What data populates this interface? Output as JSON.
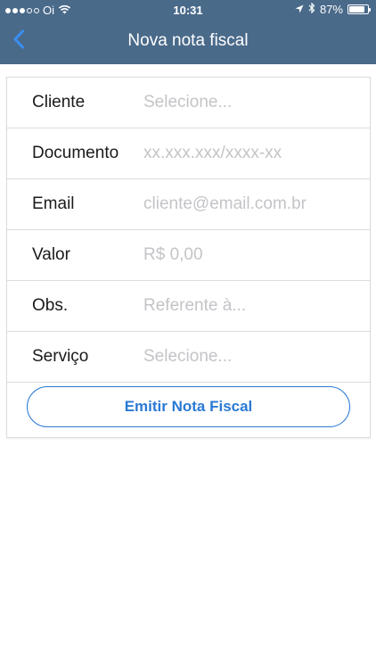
{
  "status_bar": {
    "carrier": "Oi",
    "time": "10:31",
    "battery": "87%",
    "battery_level": 0.87,
    "icons": [
      "signal-dots-icon",
      "wifi-icon",
      "location-arrow-icon",
      "bluetooth-icon",
      "battery-icon"
    ]
  },
  "nav": {
    "title": "Nova nota fiscal",
    "back_icon": "chevron-left-icon"
  },
  "form": {
    "fields": [
      {
        "label": "Cliente",
        "placeholder": "Selecione...",
        "value": ""
      },
      {
        "label": "Documento",
        "placeholder": "xx.xxx.xxx/xxxx-xx",
        "value": ""
      },
      {
        "label": "Email",
        "placeholder": "cliente@email.com.br",
        "value": ""
      },
      {
        "label": "Valor",
        "placeholder": "R$ 0,00",
        "value": ""
      },
      {
        "label": "Obs.",
        "placeholder": "Referente à...",
        "value": ""
      },
      {
        "label": "Serviço",
        "placeholder": "Selecione...",
        "value": ""
      }
    ],
    "submit_label": "Emitir Nota Fiscal"
  },
  "colors": {
    "header_bg": "#4a6a8a",
    "accent": "#2a7ad4",
    "placeholder": "#c4c4c8"
  }
}
